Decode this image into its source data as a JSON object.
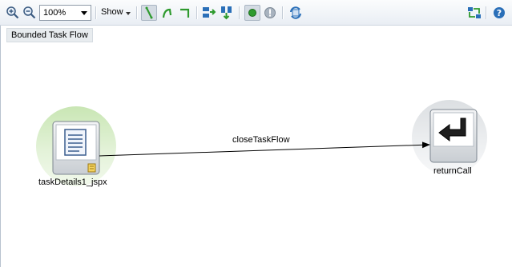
{
  "toolbar": {
    "zoom_value": "100%",
    "show_label": "Show",
    "icons": [
      "zoom-in-icon",
      "zoom-out-icon",
      "straight-line-icon",
      "curved-line-icon",
      "right-angle-line-icon",
      "layout-horizontal-icon",
      "layout-vertical-icon",
      "default-activity-icon",
      "exception-handler-icon",
      "refresh-icon",
      "fit-diagram-icon",
      "help-icon"
    ]
  },
  "canvas": {
    "flow_title": "Bounded Task Flow",
    "nodes": [
      {
        "id": "view",
        "label": "taskDetails1_jspx",
        "kind": "view-activity"
      },
      {
        "id": "return",
        "label": "returnCall",
        "kind": "task-flow-return"
      }
    ],
    "edge": {
      "label": "closeTaskFlow",
      "from": "view",
      "to": "return"
    }
  },
  "colors": {
    "view_halo": "#d6ecc6",
    "return_halo": "#e6e8ea",
    "toolbar_green": "#2e9a2e",
    "toolbar_blue": "#2a6fb8"
  }
}
